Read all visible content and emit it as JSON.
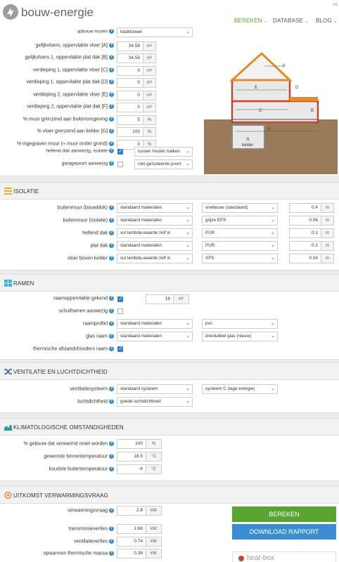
{
  "header": {
    "brand": "bouw-energie",
    "corner": "co",
    "nav": [
      "BEREKEN",
      "DATABASE",
      "BLOG"
    ]
  },
  "building": {
    "rows": [
      {
        "label": "opbouw muren",
        "type": "select",
        "value": "traditioneel"
      },
      {
        "label": "gelijkvloers, oppervlakte vloer [A]",
        "type": "num",
        "value": "34.58",
        "unit": "m²"
      },
      {
        "label": "gelijkvloers 1, oppervlakte plat dak [B]",
        "type": "num",
        "value": "34.58",
        "unit": "m²"
      },
      {
        "label": "verdieping 1, oppervlakte vloer [C]",
        "type": "num",
        "value": "0",
        "unit": "m²"
      },
      {
        "label": "verdieping 1, oppervlakte plat dak [D]",
        "type": "num",
        "value": "0",
        "unit": "m²"
      },
      {
        "label": "verdieping 2, oppervlakte vloer [E]",
        "type": "num",
        "value": "0",
        "unit": "m²"
      },
      {
        "label": "verdieping 2, oppervlakte plat dak [F]",
        "type": "num",
        "value": "0",
        "unit": "m²"
      },
      {
        "label": "% muur grenzend aan buitenomgeving",
        "type": "num",
        "value": "5",
        "unit": "%"
      },
      {
        "label": "% vloer grenzend aan kelder [G]",
        "type": "num",
        "value": "100",
        "unit": "%"
      },
      {
        "label": "% ingegraven muur (+ muur onder grond)",
        "type": "num",
        "value": "0",
        "unit": "%"
      },
      {
        "label": "hellend dak aanwezig, isolatie",
        "type": "chksel",
        "checked": true,
        "value": "tussen houten balken"
      },
      {
        "label": "garagepoort aanwezig",
        "type": "chksel",
        "checked": false,
        "value": "niet-geïsoleerde poort"
      }
    ],
    "diagram_labels": [
      "F",
      "E",
      "D",
      "C",
      "B",
      "A",
      "G",
      "kelder"
    ]
  },
  "isolatie": {
    "title": "ISOLATIE",
    "rows": [
      {
        "label": "buitenmuur (bouwblok)",
        "sel1": "standaard materialen",
        "sel2": "snelbouw (standaard)",
        "value": "0.4",
        "unit": "m"
      },
      {
        "label": "buitenmuur (isolatie)",
        "sel1": "standaard materialen",
        "sel2": "grijze EPS",
        "value": "0.06",
        "unit": "m"
      },
      {
        "label": "hellend dak",
        "sel1": "vul lambda-waarde zelf in",
        "sel2": "PUR",
        "value": "0.1",
        "unit": "m"
      },
      {
        "label": "plat dak",
        "sel1": "standaard materialen",
        "sel2": "PUR",
        "value": "0.1",
        "unit": "m"
      },
      {
        "label": "vloer boven kelder",
        "sel1": "vul lambda-waarde zelf in",
        "sel2": "XPS",
        "value": "0.04",
        "unit": "m"
      }
    ]
  },
  "ramen": {
    "title": "RAMEN",
    "raam_label": "raamoppervlakte gekend",
    "raam_checked": true,
    "raam_value": "16",
    "raam_unit": "m²",
    "schuif_label": "schuiframen aanwezig",
    "schuif_checked": false,
    "profiel_label": "raamprofiel",
    "profiel_sel1": "standaard materialen",
    "profiel_sel2": "pvc",
    "glas_label": "glas raam",
    "glas_sel1": "standaard materialen",
    "glas_sel2": "driedubbel glas (nieuw)",
    "thermisch_label": "thermische afstandshouders raam",
    "thermisch_checked": true
  },
  "ventilatie": {
    "title": "VENTILATIE EN LUCHTDICHTHEID",
    "systeem_label": "ventilatiesysteem",
    "systeem_sel1": "standaard systeem",
    "systeem_sel2": "systeem C (lage energie)",
    "lucht_label": "luchtdichtheid",
    "lucht_sel": "goede luchtdichtheid"
  },
  "klimaat": {
    "title": "KLIMATOLOGISCHE OMSTANDIGHEDEN",
    "rows": [
      {
        "label": "% gebouw dat verwarmd moet worden",
        "value": "100",
        "unit": "%"
      },
      {
        "label": "gewenste binnentemperatuur",
        "value": "18.5",
        "unit": "°C"
      },
      {
        "label": "koudste buitentemperatuur",
        "value": "-4",
        "unit": "°C"
      }
    ]
  },
  "uitkomst": {
    "title": "UITKOMST VERWARMINGSVRAAG",
    "rows": [
      {
        "label": "verwarmingsvraag",
        "value": "2.8",
        "unit": "kW"
      },
      {
        "label": "transmissieverlies",
        "value": "1.68",
        "unit": "kW"
      },
      {
        "label": "ventilatieverlies",
        "value": "0.74",
        "unit": "kW"
      },
      {
        "label": "opwarmen thermische massa",
        "value": "0.38",
        "unit": "kW"
      }
    ],
    "bereken_label": "BEREKEN",
    "download_label": "DOWNLOAD RAPPORT",
    "ad_text": "heat-box"
  },
  "colors": {
    "green": "#5aa531",
    "blue": "#3a8dd0",
    "orange": "#e48a2a"
  }
}
